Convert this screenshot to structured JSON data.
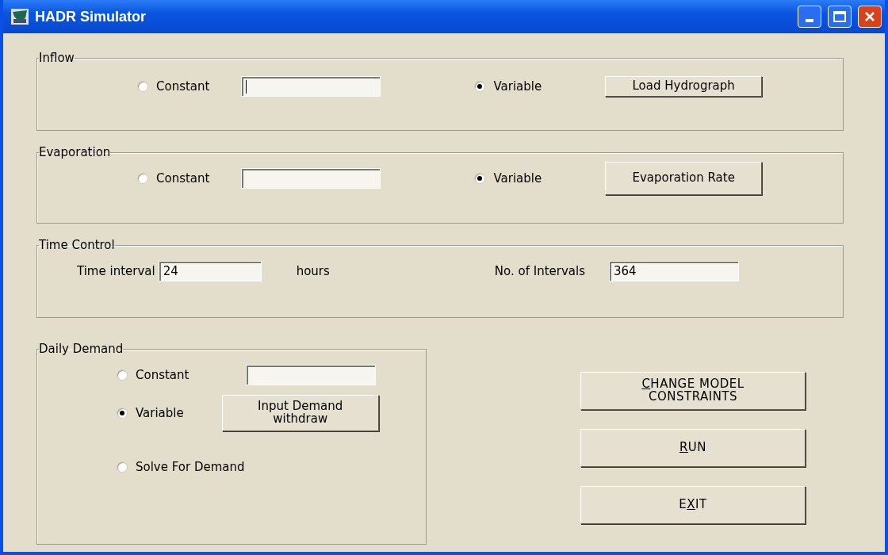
{
  "window": {
    "title": "HADR Simulator"
  },
  "inflow": {
    "title": "Inflow",
    "options": [
      {
        "label": "Constant",
        "selected": false
      },
      {
        "label": "Variable",
        "selected": true
      }
    ],
    "constant_field": {
      "focused": true
    },
    "button": "Load Hydrograph"
  },
  "evaporation": {
    "title": "Evaporation",
    "options": [
      {
        "label": "Constant",
        "selected": false
      },
      {
        "label": "Variable",
        "selected": true
      }
    ],
    "constant_field": {
      "focused": false
    },
    "button": "Evaporation Rate"
  },
  "time_control": {
    "title": "Time Control",
    "interval_label": "Time interval",
    "interval_value": "24",
    "interval_unit": "hours",
    "count_label": "No. of Intervals",
    "count_value": "364"
  },
  "daily_demand": {
    "title": "Daily Demand",
    "options": [
      {
        "label": "Constant",
        "selected": false
      },
      {
        "label": "Variable",
        "selected": true
      },
      {
        "label": "Solve For Demand",
        "selected": false
      }
    ],
    "button": "Input Demand\nwithdraw"
  },
  "buttons": [
    {
      "key": "C",
      "post": "HANGE MODEL\nCONSTRAINTS"
    },
    {
      "key": "R",
      "post": "UN"
    },
    {
      "pre": "E",
      "key": "X",
      "post": "IT"
    }
  ]
}
